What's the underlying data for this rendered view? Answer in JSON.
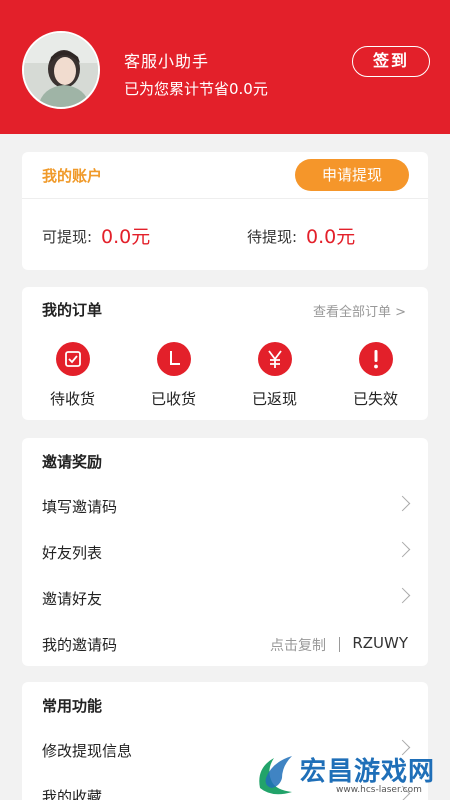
{
  "header": {
    "username": "客服小助手",
    "savings_text": "已为您累计节省0.0元",
    "checkin_label": "签到"
  },
  "account": {
    "title": "我的账户",
    "withdraw_button": "申请提现",
    "available_label": "可提现:",
    "available_value": "0.0元",
    "pending_label": "待提现:",
    "pending_value": "0.0元"
  },
  "orders": {
    "title": "我的订单",
    "view_all": "查看全部订单 >",
    "items": [
      {
        "label": "待收货",
        "icon": "checkbox-icon"
      },
      {
        "label": "已收货",
        "icon": "clock-icon"
      },
      {
        "label": "已返现",
        "icon": "yen-icon"
      },
      {
        "label": "已失效",
        "icon": "exclamation-icon"
      }
    ]
  },
  "invite": {
    "title": "邀请奖励",
    "items": [
      "填写邀请码",
      "好友列表",
      "邀请好友"
    ],
    "code_label": "我的邀请码",
    "copy_text": "点击复制",
    "code_value": "RZUWY"
  },
  "common": {
    "title": "常用功能",
    "items": [
      "修改提现信息",
      "我的收藏"
    ]
  },
  "watermark": {
    "text": "宏昌游戏网",
    "url": "www.hcs-laser.com"
  },
  "colors": {
    "brand_red": "#e3202a",
    "accent_orange": "#f5962a",
    "watermark_blue": "#1f6fb8"
  }
}
